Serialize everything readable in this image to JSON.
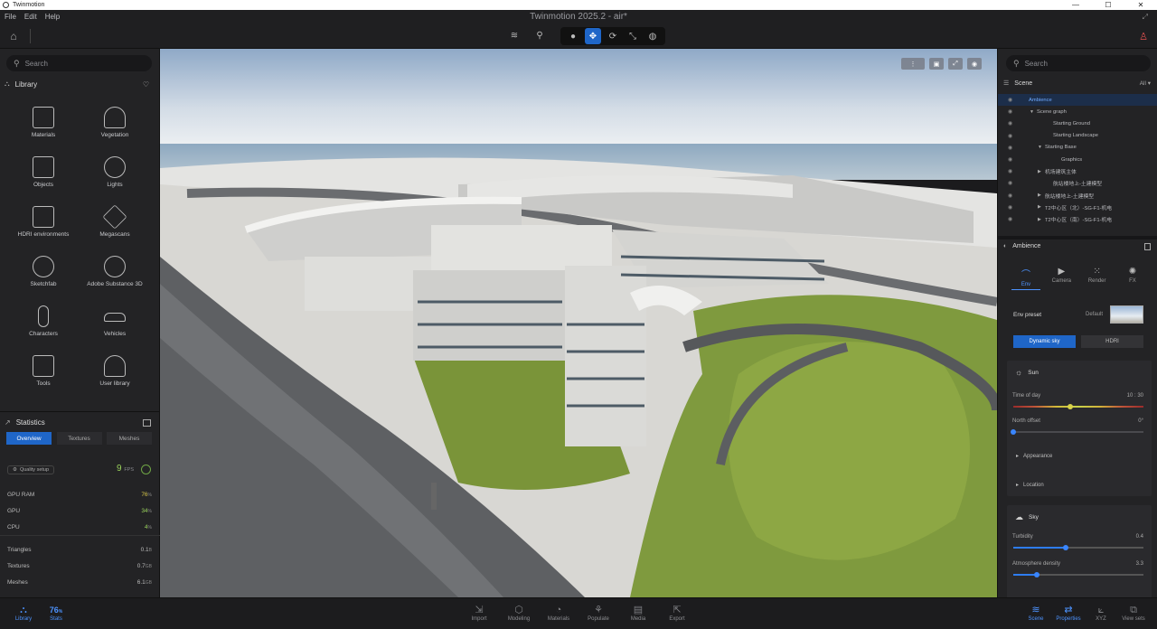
{
  "window": {
    "app_name": "Twinmotion",
    "title": "Twinmotion 2025.2 - air*"
  },
  "menu": [
    "File",
    "Edit",
    "Help"
  ],
  "left_panel": {
    "search_placeholder": "Search",
    "library_title": "Library",
    "library_items": [
      "Materials",
      "Vegetation",
      "Objects",
      "Lights",
      "HDRI environments",
      "Megascans",
      "Sketchfab",
      "Adobe Substance 3D",
      "Characters",
      "Vehicles",
      "Tools",
      "User library"
    ]
  },
  "statistics": {
    "title": "Statistics",
    "tabs": [
      "Overview",
      "Textures",
      "Meshes"
    ],
    "quality_label": "Quality setup",
    "fps_value": "9",
    "fps_unit": "FPS",
    "rows": [
      {
        "label": "GPU RAM",
        "value": "76",
        "unit": "%",
        "color": "#d9c84a"
      },
      {
        "label": "GPU",
        "value": "34",
        "unit": "%",
        "color": "#9ad35b"
      },
      {
        "label": "CPU",
        "value": "4",
        "unit": "%",
        "color": "#9ad35b"
      }
    ],
    "rows2": [
      {
        "label": "Triangles",
        "value": "0.1",
        "unit": "B"
      },
      {
        "label": "Textures",
        "value": "0.7",
        "unit": "GB"
      },
      {
        "label": "Meshes",
        "value": "6.1",
        "unit": "GB"
      }
    ]
  },
  "right_panel": {
    "search_placeholder": "Search",
    "scene_title": "Scene",
    "filter": "All",
    "tree": [
      {
        "label": "Ambience",
        "indent": 0,
        "selected": true
      },
      {
        "label": "Scene graph",
        "indent": 1,
        "arrow": "▼"
      },
      {
        "label": "Starting Ground",
        "indent": 3
      },
      {
        "label": "Starting Landscape",
        "indent": 3
      },
      {
        "label": "Starting Base",
        "indent": 2,
        "arrow": "▼"
      },
      {
        "label": "Graphics",
        "indent": 4
      },
      {
        "label": "机场建筑主体",
        "indent": 2,
        "arrow": "▶"
      },
      {
        "label": "航站楼地上-土建模型",
        "indent": 3
      },
      {
        "label": "航站楼地上-土建模型",
        "indent": 2,
        "arrow": "▶"
      },
      {
        "label": "T2中心区（北）-SG-F1-机电",
        "indent": 2,
        "arrow": "▶"
      },
      {
        "label": "T2中心区（南）-SG-F1-机电",
        "indent": 2,
        "arrow": "▶"
      }
    ],
    "ambience_title": "Ambience",
    "ambience_tabs": [
      "Env",
      "Camera",
      "Render",
      "FX"
    ],
    "env_preset_label": "Env preset",
    "env_preset_value": "Default",
    "sky_modes": [
      "Dynamic sky",
      "HDRI"
    ],
    "sun": {
      "title": "Sun",
      "time_label": "Time of day",
      "time_value": "10 : 30",
      "time_fraction": 0.44,
      "north_label": "North offset",
      "north_value": "0°",
      "north_fraction": 0.0,
      "appearance": "Appearance",
      "location": "Location"
    },
    "sky": {
      "title": "Sky",
      "turbidity_label": "Turbidity",
      "turbidity_value": "0.4",
      "turbidity_fraction": 0.4,
      "atmo_label": "Atmosphere density",
      "atmo_value": "3.3",
      "atmo_fraction": 0.18
    }
  },
  "bottom_bar": {
    "library": "Library",
    "stats_value": "76",
    "stats_unit": "%",
    "stats": "Stats",
    "center": [
      "Import",
      "Modeling",
      "Materials",
      "Populate",
      "Media",
      "Export"
    ],
    "right": [
      "Scene",
      "Properties",
      "XYZ",
      "View sets"
    ]
  }
}
